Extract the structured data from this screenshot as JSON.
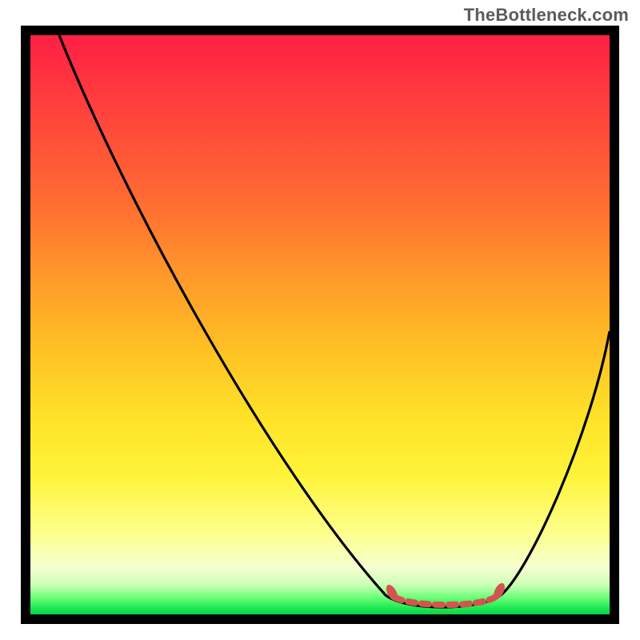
{
  "watermark": "TheBottleneck.com",
  "chart_data": {
    "type": "line",
    "title": "",
    "xlabel": "",
    "ylabel": "",
    "xlim": [
      0,
      100
    ],
    "ylim": [
      0,
      100
    ],
    "series": [
      {
        "name": "curve",
        "x": [
          5,
          10,
          15,
          20,
          25,
          30,
          35,
          40,
          45,
          50,
          55,
          60,
          65,
          70,
          75,
          80,
          85,
          90,
          95,
          100
        ],
        "values": [
          100,
          92,
          84,
          76,
          68,
          60,
          52,
          44,
          36,
          28,
          20,
          12,
          6,
          2,
          1,
          3,
          12,
          24,
          38,
          52
        ]
      }
    ],
    "plateau": {
      "x_start": 63,
      "x_end": 80,
      "y": 2.5
    },
    "markers": [
      {
        "x": 63,
        "y": 4,
        "kind": "cap"
      },
      {
        "x": 80,
        "y": 5,
        "kind": "cap"
      }
    ],
    "grid": false,
    "legend": false
  },
  "colors": {
    "frame": "#000000",
    "curve": "#000000",
    "plateau": "#d3554f",
    "marker": "#d3554f"
  }
}
